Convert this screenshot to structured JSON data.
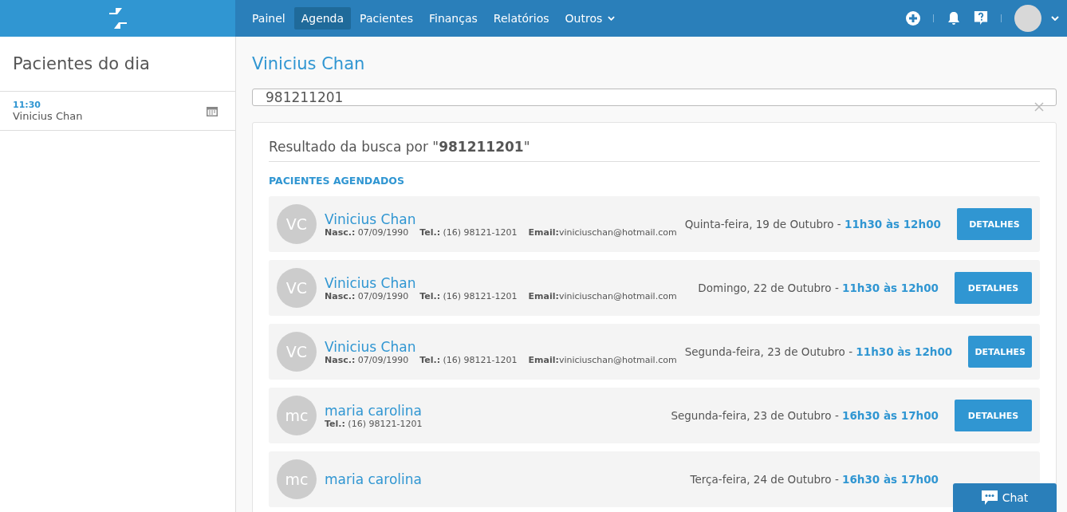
{
  "nav": {
    "items": [
      {
        "label": "Painel",
        "selected": false
      },
      {
        "label": "Agenda",
        "selected": true
      },
      {
        "label": "Pacientes",
        "selected": false
      },
      {
        "label": "Finanças",
        "selected": false
      },
      {
        "label": "Relatórios",
        "selected": false
      },
      {
        "label": "Outros",
        "selected": false,
        "dropdown": true
      }
    ]
  },
  "sidebar": {
    "title": "Pacientes do dia",
    "items": [
      {
        "time": "11:30",
        "name": "Vinicius Chan"
      }
    ]
  },
  "main": {
    "title": "Vinicius Chan",
    "search": {
      "value": "981211201"
    },
    "results": {
      "heading": "Resultado da busca por \"**981211201**\"",
      "section": "PACIENTES AGENDADOS",
      "rows": [
        {
          "initials": "VC",
          "name": "Vinicius Chan",
          "details": [
            {
              "label": "Nasc.:",
              "value": " 07/09/1990"
            },
            {
              "label": "Tel.:",
              "value": " (16) 98121-1201"
            },
            {
              "label": "Email:",
              "value": "viniciuschan@hotmail.com"
            }
          ],
          "date": "Quinta-feira, 19 de Outubro - ",
          "time": "11h30 às 12h00",
          "button": "DETALHES"
        },
        {
          "initials": "VC",
          "name": "Vinicius Chan",
          "details": [
            {
              "label": "Nasc.:",
              "value": " 07/09/1990"
            },
            {
              "label": "Tel.:",
              "value": " (16) 98121-1201"
            },
            {
              "label": "Email:",
              "value": "viniciuschan@hotmail.com"
            }
          ],
          "date": "Domingo, 22 de Outubro - ",
          "time": "11h30 às 12h00",
          "button": "DETALHES"
        },
        {
          "initials": "VC",
          "name": "Vinicius Chan",
          "details": [
            {
              "label": "Nasc.:",
              "value": " 07/09/1990"
            },
            {
              "label": "Tel.:",
              "value": " (16) 98121-1201"
            },
            {
              "label": "Email:",
              "value": "viniciuschan@hotmail.com"
            }
          ],
          "date": "Segunda-feira, 23 de Outubro - ",
          "time": "11h30 às 12h00",
          "button": "DETALHES"
        },
        {
          "initials": "mc",
          "name": "maria carolina",
          "details": [
            {
              "label": "Tel.:",
              "value": " (16) 98121-1201"
            }
          ],
          "date": "Segunda-feira, 23 de Outubro - ",
          "time": "16h30 às 17h00",
          "button": "DETALHES"
        },
        {
          "initials": "mc",
          "name": "maria carolina",
          "details": [],
          "date": "Terça-feira, 24 de Outubro - ",
          "time": "16h30 às 17h00"
        }
      ]
    }
  },
  "chat": {
    "label": "Chat"
  }
}
